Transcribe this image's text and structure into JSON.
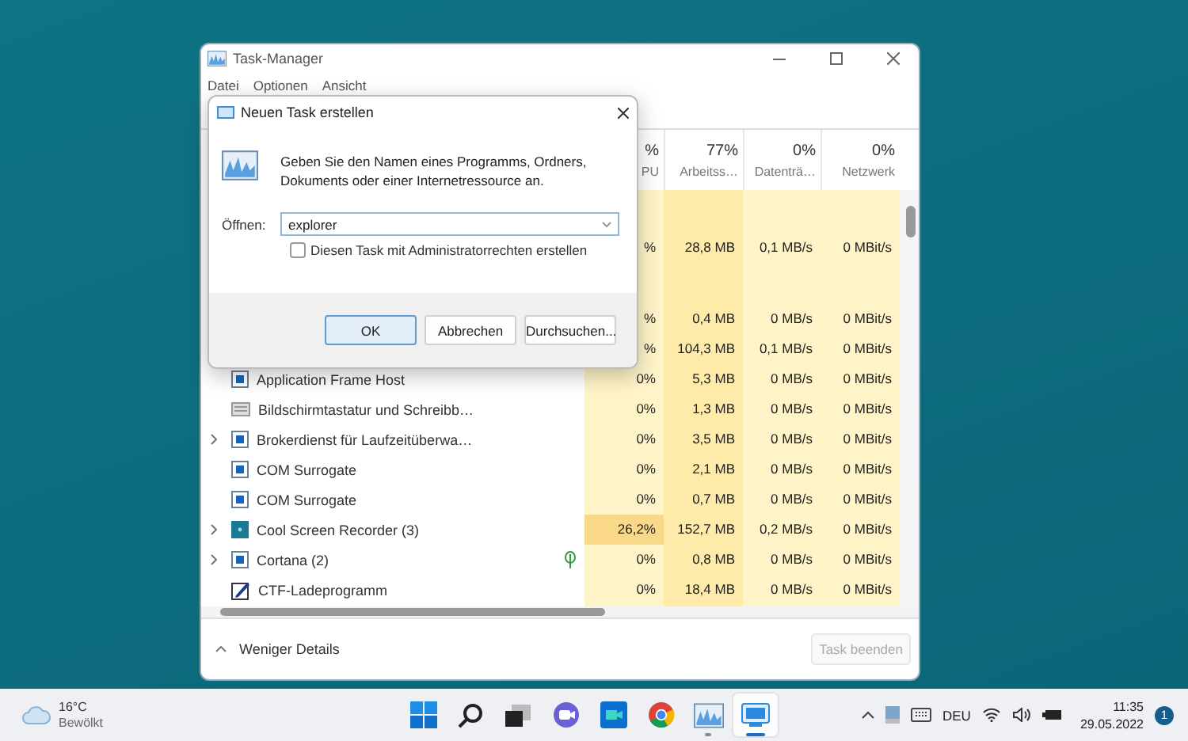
{
  "task_manager": {
    "title": "Task-Manager",
    "menu": [
      "Datei",
      "Optionen",
      "Ansicht"
    ],
    "columns": [
      {
        "value": "%",
        "label": "PU"
      },
      {
        "value": "77%",
        "label": "Arbeitss…"
      },
      {
        "value": "0%",
        "label": "Datenträ…"
      },
      {
        "value": "0%",
        "label": "Netzwerk"
      }
    ],
    "rows": [
      {
        "busy": false,
        "cpu": "%",
        "memory": "28,8 MB",
        "disk": "0,1 MB/s",
        "network": "0 MBit/s"
      },
      {
        "busy": false,
        "cpu": "%",
        "memory": "0,4 MB",
        "disk": "0 MB/s",
        "network": "0 MBit/s"
      },
      {
        "busy": false,
        "cpu": "%",
        "memory": "104,3 MB",
        "disk": "0,1 MB/s",
        "network": "0 MBit/s"
      },
      {
        "name": "Application Frame Host",
        "kind": "window",
        "expandable": false,
        "efficiency": false,
        "busy": false,
        "cpu": "0%",
        "memory": "5,3 MB",
        "disk": "0 MB/s",
        "network": "0 MBit/s"
      },
      {
        "name": "Bildschirmtastatur und Schreibb…",
        "kind": "keyboard",
        "expandable": false,
        "efficiency": false,
        "busy": false,
        "cpu": "0%",
        "memory": "1,3 MB",
        "disk": "0 MB/s",
        "network": "0 MBit/s"
      },
      {
        "name": "Brokerdienst für Laufzeitüberwa…",
        "kind": "window",
        "expandable": true,
        "efficiency": false,
        "busy": false,
        "cpu": "0%",
        "memory": "3,5 MB",
        "disk": "0 MB/s",
        "network": "0 MBit/s"
      },
      {
        "name": "COM Surrogate",
        "kind": "window",
        "expandable": false,
        "efficiency": false,
        "busy": false,
        "cpu": "0%",
        "memory": "2,1 MB",
        "disk": "0 MB/s",
        "network": "0 MBit/s"
      },
      {
        "name": "COM Surrogate",
        "kind": "window",
        "expandable": false,
        "efficiency": false,
        "busy": false,
        "cpu": "0%",
        "memory": "0,7 MB",
        "disk": "0 MB/s",
        "network": "0 MBit/s"
      },
      {
        "name": "Cool Screen Recorder (3)",
        "kind": "recorder",
        "expandable": true,
        "efficiency": false,
        "busy": true,
        "cpu": "26,2%",
        "memory": "152,7 MB",
        "disk": "0,2 MB/s",
        "network": "0 MBit/s"
      },
      {
        "name": "Cortana (2)",
        "kind": "window",
        "expandable": true,
        "efficiency": true,
        "busy": false,
        "cpu": "0%",
        "memory": "0,8 MB",
        "disk": "0 MB/s",
        "network": "0 MBit/s"
      },
      {
        "name": "CTF-Ladeprogramm",
        "kind": "pen",
        "expandable": false,
        "efficiency": false,
        "busy": false,
        "cpu": "0%",
        "memory": "18,4 MB",
        "disk": "0 MB/s",
        "network": "0 MBit/s"
      }
    ],
    "details_toggle": "Weniger Details",
    "end_task": {
      "label": "Task beenden",
      "disabled": true
    }
  },
  "dialog": {
    "title": "Neuen Task erstellen",
    "message": "Geben Sie den Namen eines Programms, Ordners, Dokuments oder einer Internetressource an.",
    "open_label": "Öffnen:",
    "open_value": "explorer",
    "admin_checkbox": {
      "label": "Diesen Task mit Administratorrechten erstellen",
      "checked": false
    },
    "buttons": [
      {
        "label": "OK",
        "default": true
      },
      {
        "label": "Abbrechen",
        "default": false
      },
      {
        "label": "Durchsuchen...",
        "default": false
      }
    ]
  },
  "taskbar": {
    "weather": {
      "temperature": "16°C",
      "condition": "Bewölkt"
    },
    "apps": [
      {
        "kind": "start",
        "running": false,
        "selected": false
      },
      {
        "kind": "search",
        "running": false,
        "selected": false
      },
      {
        "kind": "taskview",
        "running": false,
        "selected": false
      },
      {
        "kind": "chat",
        "running": false,
        "selected": false
      },
      {
        "kind": "meet",
        "running": false,
        "selected": false
      },
      {
        "kind": "chrome",
        "running": false,
        "selected": false
      },
      {
        "kind": "taskmanager",
        "running": true,
        "selected": false
      },
      {
        "kind": "monitor",
        "running": true,
        "selected": true
      }
    ],
    "language": "DEU",
    "time": "11:35",
    "date": "29.05.2022",
    "notifications": "1"
  }
}
